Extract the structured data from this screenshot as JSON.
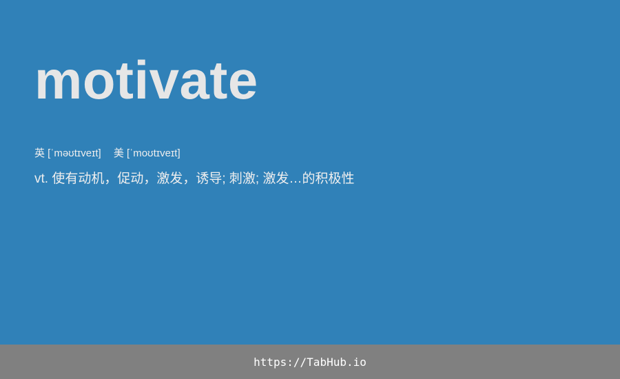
{
  "word": "motivate",
  "phonetics": {
    "uk": "英 [ˈməʊtɪveɪt]",
    "us": "美 [ˈmoʊtɪveɪt]"
  },
  "definition": "vt. 使有动机，促动，激发，诱导; 刺激; 激发…的积极性",
  "footer": {
    "link_text": "https://TabHub.io"
  },
  "colors": {
    "background": "#3081b8",
    "footer_background": "#808080",
    "word_text": "#e6e6e6",
    "body_text": "#eeeeee"
  }
}
